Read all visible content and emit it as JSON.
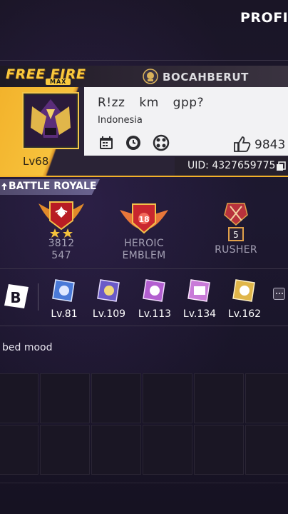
{
  "header": {
    "title": "PROFIL"
  },
  "card": {
    "logo_main": "FREE FIRE",
    "logo_sub": "MAX",
    "guild_name": "BOCAHBERUT",
    "nickname": "R!zz km gpp?",
    "region": "Indonesia",
    "level": "Lv68",
    "likes": "9843",
    "uid": "UID: 4327659775",
    "icons": [
      "calendar-icon",
      "clock-icon",
      "crosshair-icon"
    ]
  },
  "battle_royale": {
    "tab_label": "BATTLE ROYALE",
    "ranks": [
      {
        "id": "rank",
        "lines": [
          "3812",
          "547"
        ],
        "stars": 2
      },
      {
        "id": "heroic",
        "lines": [
          "HEROIC",
          "EMBLEM"
        ],
        "emblem_number": "18"
      },
      {
        "id": "rusher",
        "lines": [
          "RUSHER"
        ],
        "emblem_number": "5"
      }
    ]
  },
  "badges": [
    {
      "level": "Lv.81",
      "color": "#4a7ad8"
    },
    {
      "level": "Lv.109",
      "color": "#6a5ac8"
    },
    {
      "level": "Lv.113",
      "color": "#b35fd0"
    },
    {
      "level": "Lv.134",
      "color": "#c97bd8"
    },
    {
      "level": "Lv.162",
      "color": "#e0b64a"
    }
  ],
  "bio": "bed mood",
  "colors": {
    "accent_yellow": "#f2b12a",
    "background": "#14101f"
  }
}
